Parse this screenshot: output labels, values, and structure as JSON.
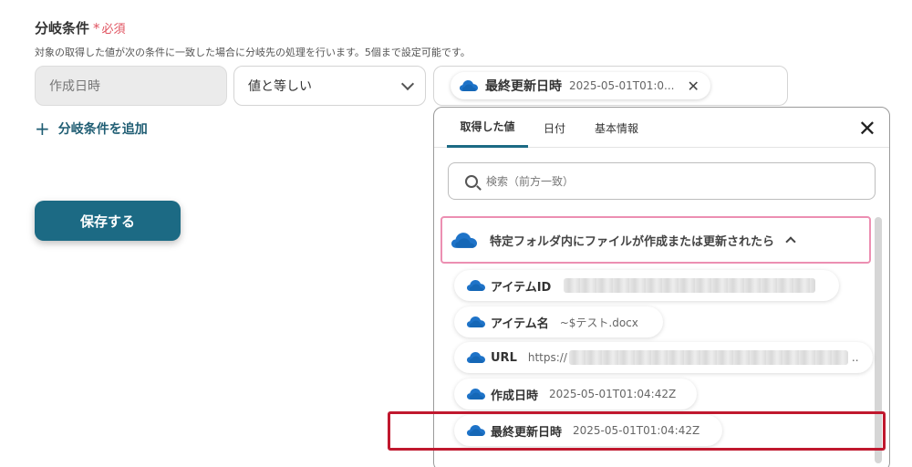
{
  "section": {
    "title": "分岐条件",
    "required_mark": "*",
    "required_label": "必須",
    "description": "対象の取得した値が次の条件に一致した場合に分岐先の処理を行います。5個まで設定可能です。"
  },
  "condition": {
    "source_field": "作成日時",
    "operator": "値と等しい",
    "value_tag": {
      "icon": "onedrive-cloud-icon",
      "label": "最終更新日時",
      "value": "2025-05-01T01:0..."
    }
  },
  "add_condition_label": "分岐条件を追加",
  "save_label": "保存する",
  "popup": {
    "tabs": [
      "取得した値",
      "日付",
      "基本情報"
    ],
    "active_tab": 0,
    "search_placeholder": "検索（前方一致）",
    "group_label": "特定フォルダ内にファイルが作成または更新されたら",
    "items": [
      {
        "label": "アイテムID",
        "value": ""
      },
      {
        "label": "アイテム名",
        "value": "~$テスト.docx"
      },
      {
        "label": "URL",
        "value": "https://",
        "value_suffix": ".."
      },
      {
        "label": "作成日時",
        "value": "2025-05-01T01:04:42Z"
      },
      {
        "label": "最終更新日時",
        "value": "2025-05-01T01:04:42Z"
      }
    ]
  },
  "colors": {
    "accent": "#1c6a84",
    "required": "#e0525f",
    "group_border": "#ec8fb2",
    "highlight": "#c0182e",
    "cloud": "#1e73c8"
  }
}
